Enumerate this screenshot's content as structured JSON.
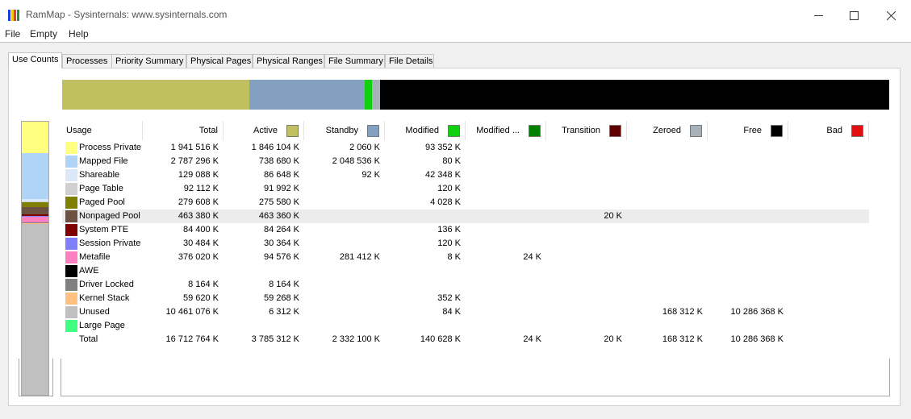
{
  "window": {
    "title": "RamMap - Sysinternals: www.sysinternals.com",
    "icon_colors": [
      "#1a3ed8",
      "#f0c814",
      "#e43b3b",
      "#2c8c3c"
    ]
  },
  "menu": [
    "File",
    "Empty",
    "Help"
  ],
  "tabs": [
    "Use Counts",
    "Processes",
    "Priority Summary",
    "Physical Pages",
    "Physical Ranges",
    "File Summary",
    "File Details"
  ],
  "active_tab": "Use Counts",
  "usage_bar": [
    {
      "name": "Active",
      "value": 3785312,
      "color": "#c0c060"
    },
    {
      "name": "Standby",
      "value": 2332100,
      "color": "#84a0c0"
    },
    {
      "name": "Modified",
      "value": 140628,
      "color": "#10d010"
    },
    {
      "name": "Zeroed",
      "value": 168312,
      "color": "#a8b0b8"
    },
    {
      "name": "Free",
      "value": 10286368,
      "color": "#000000"
    }
  ],
  "columns": [
    {
      "label": "Usage"
    },
    {
      "label": "Total"
    },
    {
      "label": "Active",
      "color": "#c0c060"
    },
    {
      "label": "Standby",
      "color": "#84a0c0"
    },
    {
      "label": "Modified",
      "color": "#10d010"
    },
    {
      "label": "Modified ...",
      "color": "#008000"
    },
    {
      "label": "Transition",
      "color": "#600000"
    },
    {
      "label": "Zeroed",
      "color": "#a8b0b8"
    },
    {
      "label": "Free",
      "color": "#000000"
    },
    {
      "label": "Bad",
      "color": "#e01010"
    }
  ],
  "rows": [
    {
      "usage": "Process Private",
      "color": "#ffff80",
      "cells": [
        "1 941 516 K",
        "1 846 104 K",
        "2 060 K",
        "93 352 K",
        "",
        "",
        "",
        "",
        ""
      ]
    },
    {
      "usage": "Mapped File",
      "color": "#b0d4f8",
      "cells": [
        "2 787 296 K",
        "738 680 K",
        "2 048 536 K",
        "80 K",
        "",
        "",
        "",
        "",
        ""
      ]
    },
    {
      "usage": "Shareable",
      "color": "#dce8f8",
      "cells": [
        "129 088 K",
        "86 648 K",
        "92 K",
        "42 348 K",
        "",
        "",
        "",
        "",
        ""
      ]
    },
    {
      "usage": "Page Table",
      "color": "#d0d0d0",
      "cells": [
        "92 112 K",
        "91 992 K",
        "",
        "120 K",
        "",
        "",
        "",
        "",
        ""
      ]
    },
    {
      "usage": "Paged Pool",
      "color": "#808000",
      "cells": [
        "279 608 K",
        "275 580 K",
        "",
        "4 028 K",
        "",
        "",
        "",
        "",
        ""
      ]
    },
    {
      "usage": "Nonpaged Pool",
      "color": "#6c5040",
      "cells": [
        "463 380 K",
        "463 360 K",
        "",
        "",
        "",
        "20 K",
        "",
        "",
        ""
      ]
    },
    {
      "usage": "System PTE",
      "color": "#800000",
      "cells": [
        "84 400 K",
        "84 264 K",
        "",
        "136 K",
        "",
        "",
        "",
        "",
        ""
      ]
    },
    {
      "usage": "Session Private",
      "color": "#8080ff",
      "cells": [
        "30 484 K",
        "30 364 K",
        "",
        "120 K",
        "",
        "",
        "",
        "",
        ""
      ]
    },
    {
      "usage": "Metafile",
      "color": "#ff80c0",
      "cells": [
        "376 020 K",
        "94 576 K",
        "281 412 K",
        "8 K",
        "24 K",
        "",
        "",
        "",
        ""
      ]
    },
    {
      "usage": "AWE",
      "color": "#000000",
      "cells": [
        "",
        "",
        "",
        "",
        "",
        "",
        "",
        "",
        ""
      ]
    },
    {
      "usage": "Driver Locked",
      "color": "#808080",
      "cells": [
        "8 164 K",
        "8 164 K",
        "",
        "",
        "",
        "",
        "",
        "",
        ""
      ]
    },
    {
      "usage": "Kernel Stack",
      "color": "#ffc080",
      "cells": [
        "59 620 K",
        "59 268 K",
        "",
        "352 K",
        "",
        "",
        "",
        "",
        ""
      ]
    },
    {
      "usage": "Unused",
      "color": "#c0c0c0",
      "cells": [
        "10 461 076 K",
        "6 312 K",
        "",
        "84 K",
        "",
        "",
        "168 312 K",
        "10 286 368 K",
        ""
      ]
    },
    {
      "usage": "Large Page",
      "color": "#40ff80",
      "cells": [
        "",
        "",
        "",
        "",
        "",
        "",
        "",
        "",
        ""
      ]
    },
    {
      "usage": "Total",
      "color": "",
      "cells": [
        "16 712 764 K",
        "3 785 312 K",
        "2 332 100 K",
        "140 628 K",
        "24 K",
        "20 K",
        "168 312 K",
        "10 286 368 K",
        ""
      ]
    }
  ],
  "selected_row": "Nonpaged Pool"
}
